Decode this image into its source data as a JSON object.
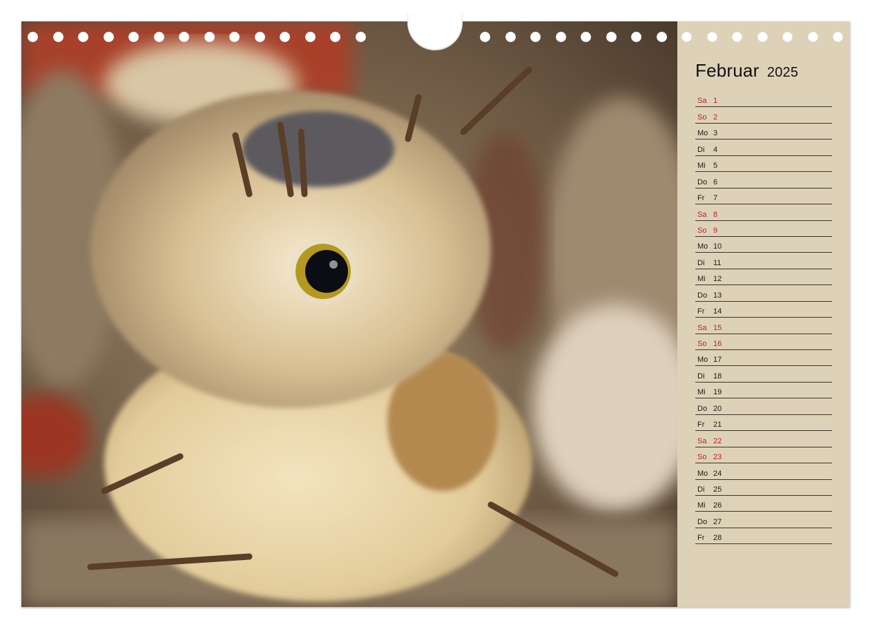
{
  "calendar": {
    "month": "Februar",
    "year": "2025",
    "colors": {
      "weekend": "#b8232b",
      "weekday": "#1a1a1a",
      "sidebar_bg": "#ddd2b7"
    },
    "days": [
      {
        "dow": "Sa",
        "day": "1",
        "weekend": true
      },
      {
        "dow": "So",
        "day": "2",
        "weekend": true
      },
      {
        "dow": "Mo",
        "day": "3",
        "weekend": false
      },
      {
        "dow": "Di",
        "day": "4",
        "weekend": false
      },
      {
        "dow": "Mi",
        "day": "5",
        "weekend": false
      },
      {
        "dow": "Do",
        "day": "6",
        "weekend": false
      },
      {
        "dow": "Fr",
        "day": "7",
        "weekend": false
      },
      {
        "dow": "Sa",
        "day": "8",
        "weekend": true
      },
      {
        "dow": "So",
        "day": "9",
        "weekend": true
      },
      {
        "dow": "Mo",
        "day": "10",
        "weekend": false
      },
      {
        "dow": "Di",
        "day": "11",
        "weekend": false
      },
      {
        "dow": "Mi",
        "day": "12",
        "weekend": false
      },
      {
        "dow": "Do",
        "day": "13",
        "weekend": false
      },
      {
        "dow": "Fr",
        "day": "14",
        "weekend": false
      },
      {
        "dow": "Sa",
        "day": "15",
        "weekend": true
      },
      {
        "dow": "So",
        "day": "16",
        "weekend": true
      },
      {
        "dow": "Mo",
        "day": "17",
        "weekend": false
      },
      {
        "dow": "Di",
        "day": "18",
        "weekend": false
      },
      {
        "dow": "Mi",
        "day": "19",
        "weekend": false
      },
      {
        "dow": "Do",
        "day": "20",
        "weekend": false
      },
      {
        "dow": "Fr",
        "day": "21",
        "weekend": false
      },
      {
        "dow": "Sa",
        "day": "22",
        "weekend": true
      },
      {
        "dow": "So",
        "day": "23",
        "weekend": true
      },
      {
        "dow": "Mo",
        "day": "24",
        "weekend": false
      },
      {
        "dow": "Di",
        "day": "25",
        "weekend": false
      },
      {
        "dow": "Mi",
        "day": "26",
        "weekend": false
      },
      {
        "dow": "Do",
        "day": "27",
        "weekend": false
      },
      {
        "dow": "Fr",
        "day": "28",
        "weekend": false
      }
    ]
  }
}
